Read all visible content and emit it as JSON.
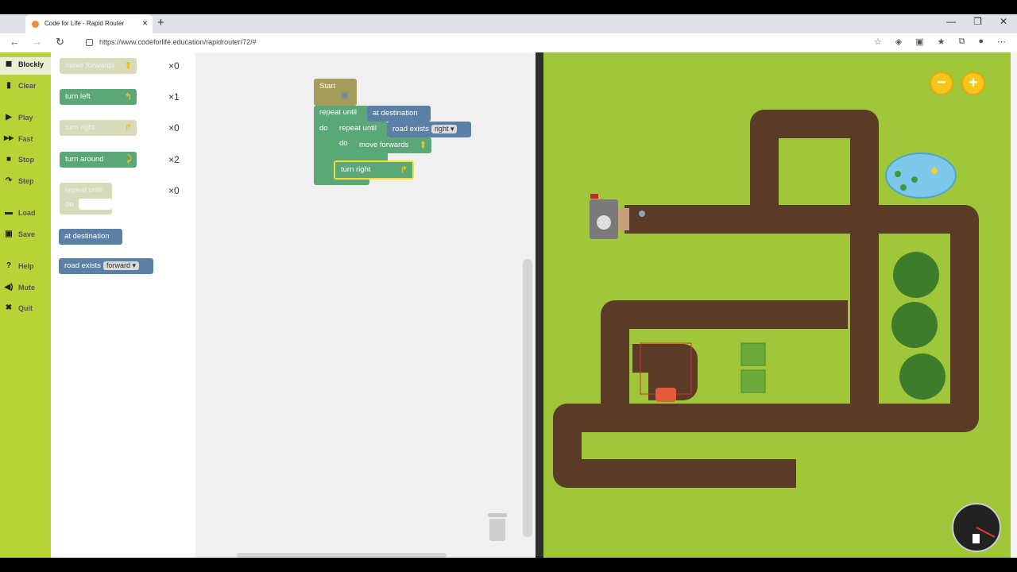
{
  "browser": {
    "tab_title": "Code for Life - Rapid Router",
    "new_tab_icon": "+",
    "url": "https://www.codeforlife.education/rapidrouter/72/#"
  },
  "menu": {
    "items": [
      {
        "label": "Blockly",
        "icon": "blockly-icon",
        "glyph": "◼"
      },
      {
        "label": "Clear",
        "icon": "trash-icon",
        "glyph": "🗑"
      },
      {
        "label": "Play",
        "icon": "play-icon",
        "glyph": "▶"
      },
      {
        "label": "Fast",
        "icon": "fast-forward-icon",
        "glyph": "▶▶"
      },
      {
        "label": "Stop",
        "icon": "stop-icon",
        "glyph": "■"
      },
      {
        "label": "Step",
        "icon": "step-icon",
        "glyph": "↷"
      },
      {
        "label": "Load",
        "icon": "folder-icon",
        "glyph": "▬"
      },
      {
        "label": "Save",
        "icon": "save-icon",
        "glyph": "💾"
      },
      {
        "label": "Help",
        "icon": "help-icon",
        "glyph": "?"
      },
      {
        "label": "Mute",
        "icon": "speaker-icon",
        "glyph": "🔊"
      },
      {
        "label": "Quit",
        "icon": "close-icon",
        "glyph": "✖"
      }
    ]
  },
  "toolbox": {
    "blocks": [
      {
        "label": "move forwards",
        "count": "×0",
        "enabled": false
      },
      {
        "label": "turn left",
        "count": "×1",
        "enabled": true
      },
      {
        "label": "turn right",
        "count": "×0",
        "enabled": false
      },
      {
        "label": "turn around",
        "count": "×2",
        "enabled": true
      },
      {
        "label": "repeat until",
        "do_label": "do",
        "count": "×0",
        "enabled": false
      }
    ],
    "conditions": [
      {
        "label": "at destination"
      },
      {
        "label": "road exists",
        "option": "forward"
      }
    ]
  },
  "workspace": {
    "start_label": "Start",
    "repeat_outer": "repeat until",
    "cond_outer": "at destination",
    "do_outer": "do",
    "repeat_inner": "repeat until",
    "cond_inner": "road exists",
    "cond_inner_option": "right",
    "do_inner": "do",
    "move_label": "move forwards",
    "turn_right_label": "turn right"
  },
  "map": {
    "zoom_out": "−",
    "zoom_in": "+",
    "colors": {
      "grass": "#a0c63a",
      "road": "#5a3b27",
      "road_edge": "#6b4a32",
      "water": "#7cc7ea",
      "tree": "#3d7c2a",
      "van": "#e25b3a"
    }
  }
}
